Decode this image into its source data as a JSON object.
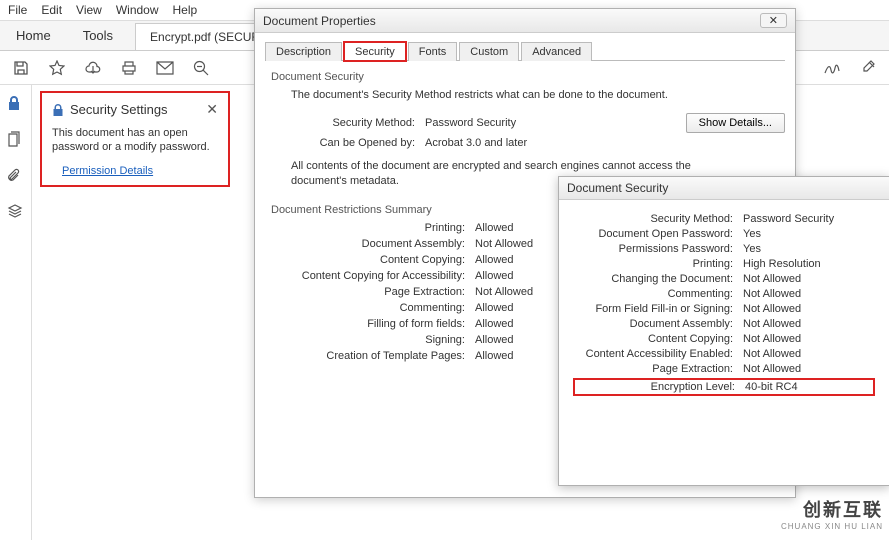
{
  "menubar": [
    "File",
    "Edit",
    "View",
    "Window",
    "Help"
  ],
  "main_tabs": {
    "home": "Home",
    "tools": "Tools",
    "doc": "Encrypt.pdf (SECUR..."
  },
  "security_panel": {
    "title": "Security Settings",
    "desc": "This document has an open password or a modify password.",
    "link": "Permission Details"
  },
  "doc_props": {
    "title": "Document Properties",
    "tabs": [
      "Description",
      "Security",
      "Fonts",
      "Custom",
      "Advanced"
    ],
    "active_tab": 1,
    "section1": "Document Security",
    "blurb": "The document's Security Method restricts what can be done to the document.",
    "rows": [
      {
        "k": "Security Method:",
        "v": "Password Security"
      },
      {
        "k": "Can be Opened by:",
        "v": "Acrobat 3.0 and later"
      }
    ],
    "show_details": "Show Details...",
    "note": "All contents of the document are encrypted and search engines cannot access the document's metadata.",
    "section2": "Document Restrictions Summary",
    "restrictions": [
      {
        "k": "Printing:",
        "v": "Allowed"
      },
      {
        "k": "Document Assembly:",
        "v": "Not Allowed"
      },
      {
        "k": "Content Copying:",
        "v": "Allowed"
      },
      {
        "k": "Content Copying for Accessibility:",
        "v": "Allowed"
      },
      {
        "k": "Page Extraction:",
        "v": "Not Allowed"
      },
      {
        "k": "Commenting:",
        "v": "Allowed"
      },
      {
        "k": "Filling of form fields:",
        "v": "Allowed"
      },
      {
        "k": "Signing:",
        "v": "Allowed"
      },
      {
        "k": "Creation of Template Pages:",
        "v": "Allowed"
      }
    ]
  },
  "doc_sec": {
    "title": "Document Security",
    "rows": [
      {
        "k": "Security Method:",
        "v": "Password Security"
      },
      {
        "k": "Document Open Password:",
        "v": "Yes"
      },
      {
        "k": "Permissions Password:",
        "v": "Yes"
      },
      {
        "k": "Printing:",
        "v": "High Resolution"
      },
      {
        "k": "Changing the Document:",
        "v": "Not Allowed"
      },
      {
        "k": "Commenting:",
        "v": "Not Allowed"
      },
      {
        "k": "Form Field Fill-in or Signing:",
        "v": "Not Allowed"
      },
      {
        "k": "Document Assembly:",
        "v": "Not Allowed"
      },
      {
        "k": "Content Copying:",
        "v": "Not Allowed"
      },
      {
        "k": "Content Accessibility Enabled:",
        "v": "Not Allowed"
      },
      {
        "k": "Page Extraction:",
        "v": "Not Allowed"
      },
      {
        "k": "Encryption Level:",
        "v": "40-bit RC4"
      }
    ],
    "highlight_row": 11
  },
  "logo": {
    "big": "创新互联",
    "small": "CHUANG XIN HU LIAN"
  }
}
